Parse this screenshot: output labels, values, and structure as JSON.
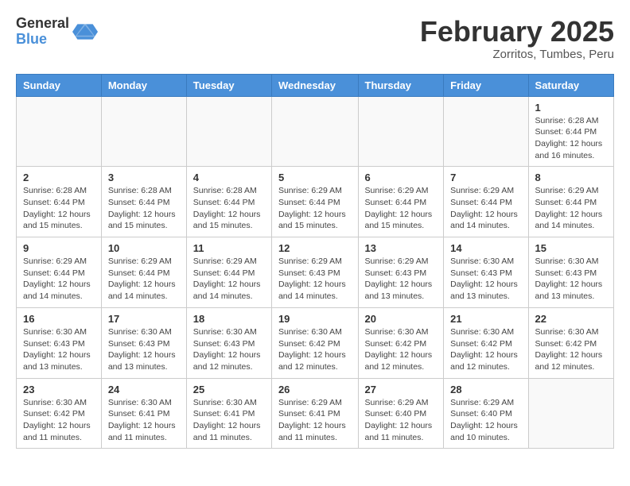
{
  "logo": {
    "general": "General",
    "blue": "Blue"
  },
  "title": {
    "month": "February 2025",
    "location": "Zorritos, Tumbes, Peru"
  },
  "headers": [
    "Sunday",
    "Monday",
    "Tuesday",
    "Wednesday",
    "Thursday",
    "Friday",
    "Saturday"
  ],
  "weeks": [
    [
      {
        "day": "",
        "info": ""
      },
      {
        "day": "",
        "info": ""
      },
      {
        "day": "",
        "info": ""
      },
      {
        "day": "",
        "info": ""
      },
      {
        "day": "",
        "info": ""
      },
      {
        "day": "",
        "info": ""
      },
      {
        "day": "1",
        "info": "Sunrise: 6:28 AM\nSunset: 6:44 PM\nDaylight: 12 hours\nand 16 minutes."
      }
    ],
    [
      {
        "day": "2",
        "info": "Sunrise: 6:28 AM\nSunset: 6:44 PM\nDaylight: 12 hours\nand 15 minutes."
      },
      {
        "day": "3",
        "info": "Sunrise: 6:28 AM\nSunset: 6:44 PM\nDaylight: 12 hours\nand 15 minutes."
      },
      {
        "day": "4",
        "info": "Sunrise: 6:28 AM\nSunset: 6:44 PM\nDaylight: 12 hours\nand 15 minutes."
      },
      {
        "day": "5",
        "info": "Sunrise: 6:29 AM\nSunset: 6:44 PM\nDaylight: 12 hours\nand 15 minutes."
      },
      {
        "day": "6",
        "info": "Sunrise: 6:29 AM\nSunset: 6:44 PM\nDaylight: 12 hours\nand 15 minutes."
      },
      {
        "day": "7",
        "info": "Sunrise: 6:29 AM\nSunset: 6:44 PM\nDaylight: 12 hours\nand 14 minutes."
      },
      {
        "day": "8",
        "info": "Sunrise: 6:29 AM\nSunset: 6:44 PM\nDaylight: 12 hours\nand 14 minutes."
      }
    ],
    [
      {
        "day": "9",
        "info": "Sunrise: 6:29 AM\nSunset: 6:44 PM\nDaylight: 12 hours\nand 14 minutes."
      },
      {
        "day": "10",
        "info": "Sunrise: 6:29 AM\nSunset: 6:44 PM\nDaylight: 12 hours\nand 14 minutes."
      },
      {
        "day": "11",
        "info": "Sunrise: 6:29 AM\nSunset: 6:44 PM\nDaylight: 12 hours\nand 14 minutes."
      },
      {
        "day": "12",
        "info": "Sunrise: 6:29 AM\nSunset: 6:43 PM\nDaylight: 12 hours\nand 14 minutes."
      },
      {
        "day": "13",
        "info": "Sunrise: 6:29 AM\nSunset: 6:43 PM\nDaylight: 12 hours\nand 13 minutes."
      },
      {
        "day": "14",
        "info": "Sunrise: 6:30 AM\nSunset: 6:43 PM\nDaylight: 12 hours\nand 13 minutes."
      },
      {
        "day": "15",
        "info": "Sunrise: 6:30 AM\nSunset: 6:43 PM\nDaylight: 12 hours\nand 13 minutes."
      }
    ],
    [
      {
        "day": "16",
        "info": "Sunrise: 6:30 AM\nSunset: 6:43 PM\nDaylight: 12 hours\nand 13 minutes."
      },
      {
        "day": "17",
        "info": "Sunrise: 6:30 AM\nSunset: 6:43 PM\nDaylight: 12 hours\nand 13 minutes."
      },
      {
        "day": "18",
        "info": "Sunrise: 6:30 AM\nSunset: 6:43 PM\nDaylight: 12 hours\nand 12 minutes."
      },
      {
        "day": "19",
        "info": "Sunrise: 6:30 AM\nSunset: 6:42 PM\nDaylight: 12 hours\nand 12 minutes."
      },
      {
        "day": "20",
        "info": "Sunrise: 6:30 AM\nSunset: 6:42 PM\nDaylight: 12 hours\nand 12 minutes."
      },
      {
        "day": "21",
        "info": "Sunrise: 6:30 AM\nSunset: 6:42 PM\nDaylight: 12 hours\nand 12 minutes."
      },
      {
        "day": "22",
        "info": "Sunrise: 6:30 AM\nSunset: 6:42 PM\nDaylight: 12 hours\nand 12 minutes."
      }
    ],
    [
      {
        "day": "23",
        "info": "Sunrise: 6:30 AM\nSunset: 6:42 PM\nDaylight: 12 hours\nand 11 minutes."
      },
      {
        "day": "24",
        "info": "Sunrise: 6:30 AM\nSunset: 6:41 PM\nDaylight: 12 hours\nand 11 minutes."
      },
      {
        "day": "25",
        "info": "Sunrise: 6:30 AM\nSunset: 6:41 PM\nDaylight: 12 hours\nand 11 minutes."
      },
      {
        "day": "26",
        "info": "Sunrise: 6:29 AM\nSunset: 6:41 PM\nDaylight: 12 hours\nand 11 minutes."
      },
      {
        "day": "27",
        "info": "Sunrise: 6:29 AM\nSunset: 6:40 PM\nDaylight: 12 hours\nand 11 minutes."
      },
      {
        "day": "28",
        "info": "Sunrise: 6:29 AM\nSunset: 6:40 PM\nDaylight: 12 hours\nand 10 minutes."
      },
      {
        "day": "",
        "info": ""
      }
    ]
  ]
}
